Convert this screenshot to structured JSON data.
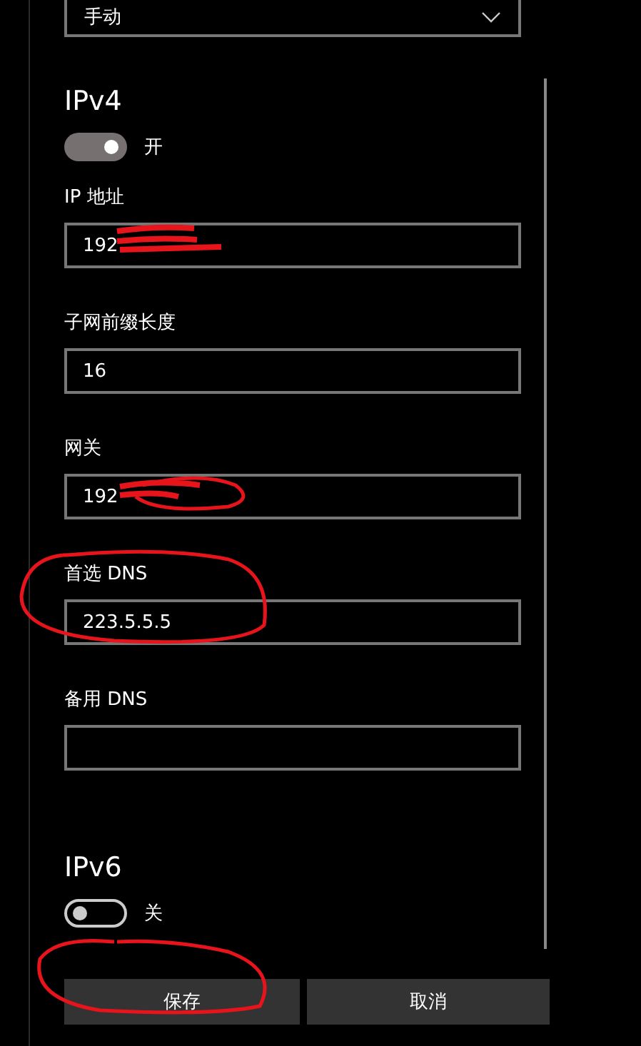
{
  "dropdown": {
    "value": "手动"
  },
  "ipv4": {
    "title": "IPv4",
    "toggle": {
      "on": true,
      "label": "开"
    }
  },
  "fields": [
    {
      "label": "IP 地址",
      "value": "192"
    },
    {
      "label": "子网前缀长度",
      "value": "16"
    },
    {
      "label": "网关",
      "value": "192"
    },
    {
      "label": "首选 DNS",
      "value": "223.5.5.5"
    },
    {
      "label": "备用 DNS"
    }
  ],
  "ipv6": {
    "title": "IPv6",
    "toggle": {
      "on": false,
      "label": "关"
    }
  },
  "buttons": [
    {
      "label": "保存"
    },
    {
      "label": "取消"
    }
  ]
}
